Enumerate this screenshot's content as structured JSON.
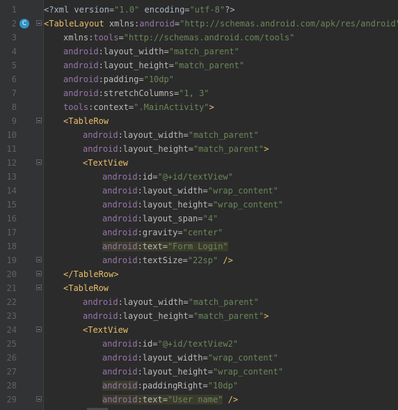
{
  "gutter": {
    "badge": "C"
  },
  "lines": [
    {
      "n": "1",
      "indent": 0,
      "fold": false,
      "badge": false,
      "segs": [
        {
          "c": "pre",
          "t": "<?xml version="
        },
        {
          "c": "val",
          "t": "\"1.0\""
        },
        {
          "c": "pre",
          "t": " encoding="
        },
        {
          "c": "val",
          "t": "\"utf-8\""
        },
        {
          "c": "pre",
          "t": "?>"
        }
      ]
    },
    {
      "n": "2",
      "indent": 0,
      "fold": true,
      "badge": true,
      "segs": [
        {
          "c": "tag",
          "t": "<TableLayout "
        },
        {
          "c": "an",
          "t": "xmlns:"
        },
        {
          "c": "ns",
          "t": "android"
        },
        {
          "c": "an",
          "t": "="
        },
        {
          "c": "val",
          "t": "\"http://schemas.android.com/apk/res/android\""
        }
      ]
    },
    {
      "n": "3",
      "indent": 4,
      "fold": false,
      "badge": false,
      "segs": [
        {
          "c": "an",
          "t": "xmlns:"
        },
        {
          "c": "ns",
          "t": "tools"
        },
        {
          "c": "an",
          "t": "="
        },
        {
          "c": "val",
          "t": "\"http://schemas.android.com/tools\""
        }
      ]
    },
    {
      "n": "4",
      "indent": 4,
      "fold": false,
      "badge": false,
      "segs": [
        {
          "c": "ns",
          "t": "android"
        },
        {
          "c": "an",
          "t": ":layout_width="
        },
        {
          "c": "val",
          "t": "\"match_parent\""
        }
      ]
    },
    {
      "n": "5",
      "indent": 4,
      "fold": false,
      "badge": false,
      "segs": [
        {
          "c": "ns",
          "t": "android"
        },
        {
          "c": "an",
          "t": ":layout_height="
        },
        {
          "c": "val",
          "t": "\"match_parent\""
        }
      ]
    },
    {
      "n": "6",
      "indent": 4,
      "fold": false,
      "badge": false,
      "segs": [
        {
          "c": "ns",
          "t": "android"
        },
        {
          "c": "an",
          "t": ":padding="
        },
        {
          "c": "val",
          "t": "\"10dp\""
        }
      ]
    },
    {
      "n": "7",
      "indent": 4,
      "fold": false,
      "badge": false,
      "segs": [
        {
          "c": "ns",
          "t": "android"
        },
        {
          "c": "an",
          "t": ":stretchColumns="
        },
        {
          "c": "val",
          "t": "\"1, 3\""
        }
      ]
    },
    {
      "n": "8",
      "indent": 4,
      "fold": false,
      "badge": false,
      "segs": [
        {
          "c": "ns",
          "t": "tools"
        },
        {
          "c": "an",
          "t": ":context="
        },
        {
          "c": "val",
          "t": "\".MainActivity\""
        },
        {
          "c": "tag",
          "t": ">"
        }
      ]
    },
    {
      "n": "9",
      "indent": 4,
      "fold": true,
      "badge": false,
      "segs": [
        {
          "c": "tag",
          "t": "<TableRow"
        }
      ]
    },
    {
      "n": "10",
      "indent": 8,
      "fold": false,
      "badge": false,
      "segs": [
        {
          "c": "ns",
          "t": "android"
        },
        {
          "c": "an",
          "t": ":layout_width="
        },
        {
          "c": "val",
          "t": "\"match_parent\""
        }
      ]
    },
    {
      "n": "11",
      "indent": 8,
      "fold": false,
      "badge": false,
      "segs": [
        {
          "c": "ns",
          "t": "android"
        },
        {
          "c": "an",
          "t": ":layout_height="
        },
        {
          "c": "val",
          "t": "\"match_parent\""
        },
        {
          "c": "tag",
          "t": ">"
        }
      ]
    },
    {
      "n": "12",
      "indent": 8,
      "fold": true,
      "badge": false,
      "segs": [
        {
          "c": "tag",
          "t": "<TextView"
        }
      ]
    },
    {
      "n": "13",
      "indent": 12,
      "fold": false,
      "badge": false,
      "segs": [
        {
          "c": "ns",
          "t": "android"
        },
        {
          "c": "an",
          "t": ":id="
        },
        {
          "c": "val",
          "t": "\"@+id/textView\""
        }
      ]
    },
    {
      "n": "14",
      "indent": 12,
      "fold": false,
      "badge": false,
      "segs": [
        {
          "c": "ns",
          "t": "android"
        },
        {
          "c": "an",
          "t": ":layout_width="
        },
        {
          "c": "val",
          "t": "\"wrap_content\""
        }
      ]
    },
    {
      "n": "15",
      "indent": 12,
      "fold": false,
      "badge": false,
      "segs": [
        {
          "c": "ns",
          "t": "android"
        },
        {
          "c": "an",
          "t": ":layout_height="
        },
        {
          "c": "val",
          "t": "\"wrap_content\""
        }
      ]
    },
    {
      "n": "16",
      "indent": 12,
      "fold": false,
      "badge": false,
      "segs": [
        {
          "c": "ns",
          "t": "android"
        },
        {
          "c": "an",
          "t": ":layout_span="
        },
        {
          "c": "val",
          "t": "\"4\""
        }
      ]
    },
    {
      "n": "17",
      "indent": 12,
      "fold": false,
      "badge": false,
      "segs": [
        {
          "c": "ns",
          "t": "android"
        },
        {
          "c": "an",
          "t": ":gravity="
        },
        {
          "c": "val",
          "t": "\"center\""
        }
      ]
    },
    {
      "n": "18",
      "indent": 12,
      "fold": false,
      "badge": false,
      "segs": [
        {
          "c": "ns",
          "t": "android",
          "h": true
        },
        {
          "c": "an",
          "t": ":text=",
          "h": true
        },
        {
          "c": "val",
          "t": "\"Form Login\"",
          "h": true
        }
      ]
    },
    {
      "n": "19",
      "indent": 12,
      "fold": true,
      "badge": false,
      "segs": [
        {
          "c": "ns",
          "t": "android"
        },
        {
          "c": "an",
          "t": ":textSize="
        },
        {
          "c": "val",
          "t": "\"22sp\""
        },
        {
          "c": "tag",
          "t": " />"
        }
      ]
    },
    {
      "n": "20",
      "indent": 4,
      "fold": true,
      "badge": false,
      "segs": [
        {
          "c": "tag",
          "t": "</TableRow>"
        }
      ]
    },
    {
      "n": "21",
      "indent": 4,
      "fold": true,
      "badge": false,
      "segs": [
        {
          "c": "tag",
          "t": "<TableRow"
        }
      ]
    },
    {
      "n": "22",
      "indent": 8,
      "fold": false,
      "badge": false,
      "segs": [
        {
          "c": "ns",
          "t": "android"
        },
        {
          "c": "an",
          "t": ":layout_width="
        },
        {
          "c": "val",
          "t": "\"match_parent\""
        }
      ]
    },
    {
      "n": "23",
      "indent": 8,
      "fold": false,
      "badge": false,
      "segs": [
        {
          "c": "ns",
          "t": "android"
        },
        {
          "c": "an",
          "t": ":layout_height="
        },
        {
          "c": "val",
          "t": "\"match_parent\""
        },
        {
          "c": "tag",
          "t": ">"
        }
      ]
    },
    {
      "n": "24",
      "indent": 8,
      "fold": true,
      "badge": false,
      "segs": [
        {
          "c": "tag",
          "t": "<TextView"
        }
      ]
    },
    {
      "n": "25",
      "indent": 12,
      "fold": false,
      "badge": false,
      "segs": [
        {
          "c": "ns",
          "t": "android"
        },
        {
          "c": "an",
          "t": ":id="
        },
        {
          "c": "val",
          "t": "\"@+id/textView2\""
        }
      ]
    },
    {
      "n": "26",
      "indent": 12,
      "fold": false,
      "badge": false,
      "segs": [
        {
          "c": "ns",
          "t": "android"
        },
        {
          "c": "an",
          "t": ":layout_width="
        },
        {
          "c": "val",
          "t": "\"wrap_content\""
        }
      ]
    },
    {
      "n": "27",
      "indent": 12,
      "fold": false,
      "badge": false,
      "segs": [
        {
          "c": "ns",
          "t": "android"
        },
        {
          "c": "an",
          "t": ":layout_height="
        },
        {
          "c": "val",
          "t": "\"wrap_content\""
        }
      ]
    },
    {
      "n": "28",
      "indent": 12,
      "fold": false,
      "badge": false,
      "segs": [
        {
          "c": "ns",
          "t": "android",
          "h": true
        },
        {
          "c": "an",
          "t": ":paddingRight="
        },
        {
          "c": "val",
          "t": "\"10dp\""
        }
      ]
    },
    {
      "n": "29",
      "indent": 12,
      "fold": true,
      "badge": false,
      "segs": [
        {
          "c": "ns",
          "t": "android",
          "h": true
        },
        {
          "c": "an",
          "t": ":text=",
          "h": true
        },
        {
          "c": "val",
          "t": "\"User name\"",
          "h": true
        },
        {
          "c": "tag",
          "t": " />"
        }
      ]
    }
  ]
}
